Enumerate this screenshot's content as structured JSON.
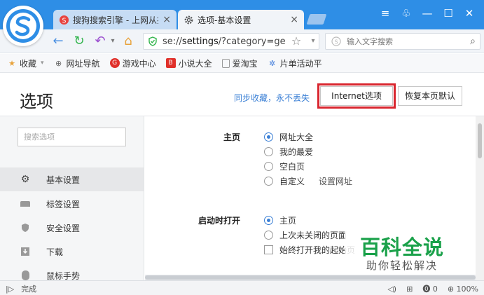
{
  "tabs": [
    {
      "title": "搜狗搜索引擎 - 上网从搜",
      "close": "×"
    },
    {
      "title": "选项-基本设置",
      "close": "×"
    }
  ],
  "window_controls": {
    "menu": "≡",
    "skin": "♧",
    "minimize": "—",
    "maximize": "☐",
    "close": "✕"
  },
  "nav": {
    "url_scheme": "se://",
    "url_host": "settings",
    "url_path": "/?category=ge",
    "search_placeholder": "输入文字搜索"
  },
  "bookmarks": [
    {
      "label": "收藏",
      "icon": "star-icon"
    },
    {
      "label": "网址导航",
      "icon": "globe-icon"
    },
    {
      "label": "游戏中心",
      "icon": "game-icon"
    },
    {
      "label": "小说大全",
      "icon": "book-icon"
    },
    {
      "label": "爱淘宝",
      "icon": "page-icon"
    },
    {
      "label": "片单活动平",
      "icon": "paw-icon"
    }
  ],
  "header": {
    "title": "选项",
    "sync_link": "同步收藏，永不丢失",
    "internet_button": "Internet选项",
    "restore_button": "恢复本页默认"
  },
  "sidebar": {
    "search_placeholder": "搜索选项",
    "items": [
      {
        "label": "基本设置",
        "icon": "gear-icon",
        "selected": true
      },
      {
        "label": "标签设置",
        "icon": "tab-icon",
        "selected": false
      },
      {
        "label": "安全设置",
        "icon": "shield-icon",
        "selected": false
      },
      {
        "label": "下载",
        "icon": "download-icon",
        "selected": false
      },
      {
        "label": "鼠标手势",
        "icon": "mouse-icon",
        "selected": false
      }
    ]
  },
  "homepage": {
    "label": "主页",
    "options": [
      "网址大全",
      "我的最爱",
      "空白页",
      "自定义"
    ],
    "selected": 0,
    "set_url_link": "设置网址"
  },
  "startup": {
    "label": "启动时打开",
    "options": [
      "主页",
      "上次未关闭的页面"
    ],
    "selected": 0,
    "checkbox_label": "始终打开我的起始页"
  },
  "watermark": {
    "title": "百科全说",
    "subtitle": "助你轻松解决"
  },
  "status": {
    "text": "完成",
    "count": "0",
    "zoom": "100%"
  },
  "colors": {
    "accent": "#2e8ee6",
    "highlight": "#d9262f",
    "link": "#3a7fd5",
    "watermark": "#1aa14a"
  }
}
